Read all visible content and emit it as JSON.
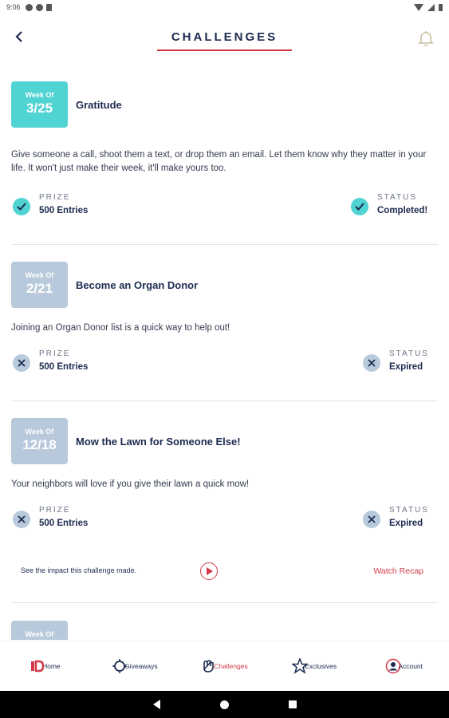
{
  "status_bar": {
    "time": "9:06"
  },
  "header": {
    "title": "CHALLENGES"
  },
  "challenges": [
    {
      "week_label": "Week Of",
      "date": "3/25",
      "title": "Gratitude",
      "description": "Give someone a call, shoot them a text, or drop them an email. Let them know why they matter in your life. It won't just make their week, it'll make yours too.",
      "prize_label": "PRIZE",
      "prize_value": "500 Entries",
      "status_label": "STATUS",
      "status_value": "Completed!",
      "state": "completed"
    },
    {
      "week_label": "Week Of",
      "date": "2/21",
      "title": "Become an Organ Donor",
      "description": "Joining an Organ Donor list is a quick way to help out!",
      "prize_label": "PRIZE",
      "prize_value": "500 Entries",
      "status_label": "STATUS",
      "status_value": "Expired",
      "state": "expired"
    },
    {
      "week_label": "Week Of",
      "date": "12/18",
      "title": "Mow the Lawn for Someone Else!",
      "description": "Your neighbors will love if you give their lawn a quick mow!",
      "prize_label": "PRIZE",
      "prize_value": "500 Entries",
      "status_label": "STATUS",
      "status_value": "Expired",
      "state": "expired",
      "impact_text": "See the impact this challenge made.",
      "recap_label": "Watch Recap"
    },
    {
      "week_label": "Week Of"
    }
  ],
  "bottom_nav": [
    {
      "label": "Home",
      "icon": "home-icon"
    },
    {
      "label": "Giveaways",
      "icon": "giveaways-icon"
    },
    {
      "label": "Challenges",
      "icon": "challenges-icon",
      "active": true
    },
    {
      "label": "Exclusives",
      "icon": "exclusives-icon"
    },
    {
      "label": "Account",
      "icon": "account-icon"
    }
  ],
  "colors": {
    "accent": "#d23a4a",
    "active_badge": "#4fd3d3",
    "expired_badge": "#b7c9da",
    "navy": "#1c2a4f"
  }
}
